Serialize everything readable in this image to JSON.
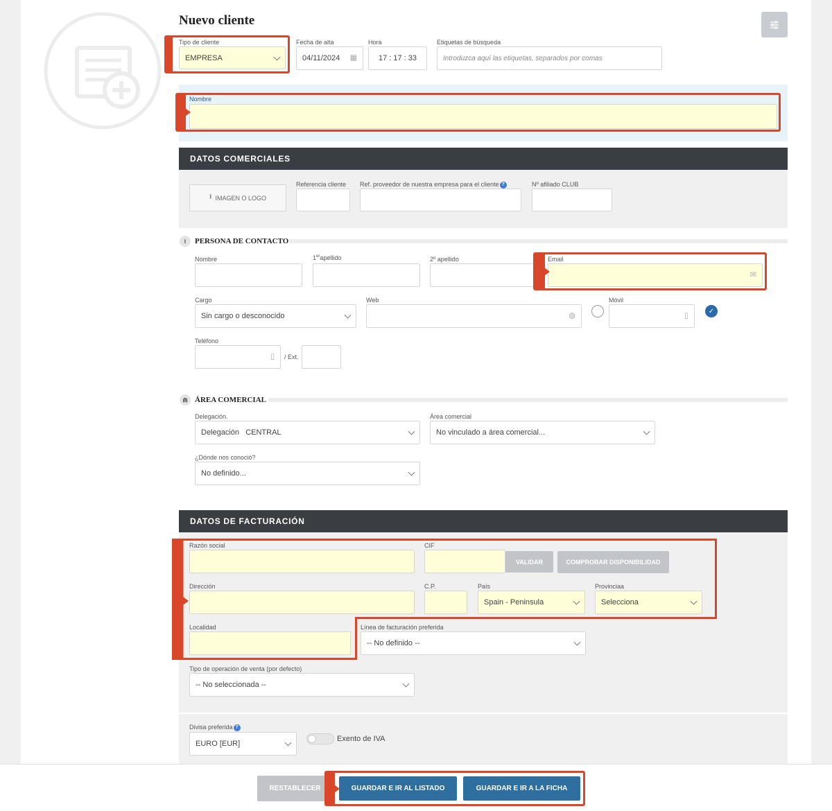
{
  "page_title": "Nuevo cliente",
  "header": {
    "tipo_cliente": {
      "label": "Tipo de cliente",
      "value": "EMPRESA"
    },
    "fecha_alta": {
      "label": "Fecha de alta",
      "value": "04/11/2024"
    },
    "hora": {
      "label": "Hora",
      "value": "17 : 17 : 33"
    },
    "etiquetas": {
      "label": "Etiquetas de búsqueda",
      "placeholder": "Introduzca aquí las etiquetas, separados por comas"
    },
    "nombre": {
      "label": "Nombre",
      "value": ""
    }
  },
  "datos_comerciales": {
    "title": "DATOS COMERCIALES",
    "imagen_button": "IMAGEN O LOGO",
    "referencia_label": "Referencia cliente",
    "ref_proveedor_label": "Ref. proveedor de nuestra empresa para el cliente",
    "afiliado_label": "Nº afiliado CLUB"
  },
  "contacto": {
    "title": "PERSONA DE CONTACTO",
    "nombre_label": "Nombre",
    "apellido1_prefix": "1",
    "apellido1_sup": "er",
    "apellido1_suffix": "apellido",
    "apellido2_label": "2º apellido",
    "email_label": "Email",
    "cargo_label": "Cargo",
    "cargo_value": "Sin cargo o desconocido",
    "web_label": "Web",
    "movil_label": "Móvil",
    "telefono_label": "Teléfono",
    "ext_label": "/ Ext."
  },
  "area_comercial": {
    "title": "ÁREA COMERCIAL",
    "delegacion_label": "Delegación.",
    "delegacion_value": "Delegación   CENTRAL",
    "area_label": "Área comercial",
    "area_value": "No vinculado a área comercial...",
    "donde_label": "¿Dónde nos conoció?",
    "donde_value": "No definido..."
  },
  "facturacion": {
    "title": "DATOS DE FACTURACIÓN",
    "razon_label": "Razón social",
    "cif_label": "CIF",
    "validar_button": "VALIDAR",
    "comprobar_button": "COMPROBAR DISPONIBILIDAD",
    "direccion_label": "Dirección",
    "cp_label": "C.P.",
    "pais_label": "País",
    "pais_value": "Spain - Peninsula",
    "provincia_label": "Provinciaa",
    "provincia_value": "Selecciona",
    "localidad_label": "Localidad",
    "linea_label": "Línea de facturación preferida",
    "linea_value": "-- No definido --",
    "tipo_op_label": "Tipo de operación de venta (por defecto)",
    "tipo_op_value": "-- No seleccionada --",
    "divisa_label": "Divisa preferida",
    "divisa_value": "EURO [EUR]",
    "exento_label": "Exento de IVA"
  },
  "footer": {
    "restablecer": "RESTABLECER",
    "guardar_listado": "GUARDAR E IR AL LISTADO",
    "guardar_ficha": "GUARDAR E IR A LA FICHA"
  },
  "colors": {
    "highlight": "#d9472b",
    "primary_button": "#2f6f9f",
    "dark_bar": "#3a3d41",
    "input_yellow": "#fefed8"
  }
}
